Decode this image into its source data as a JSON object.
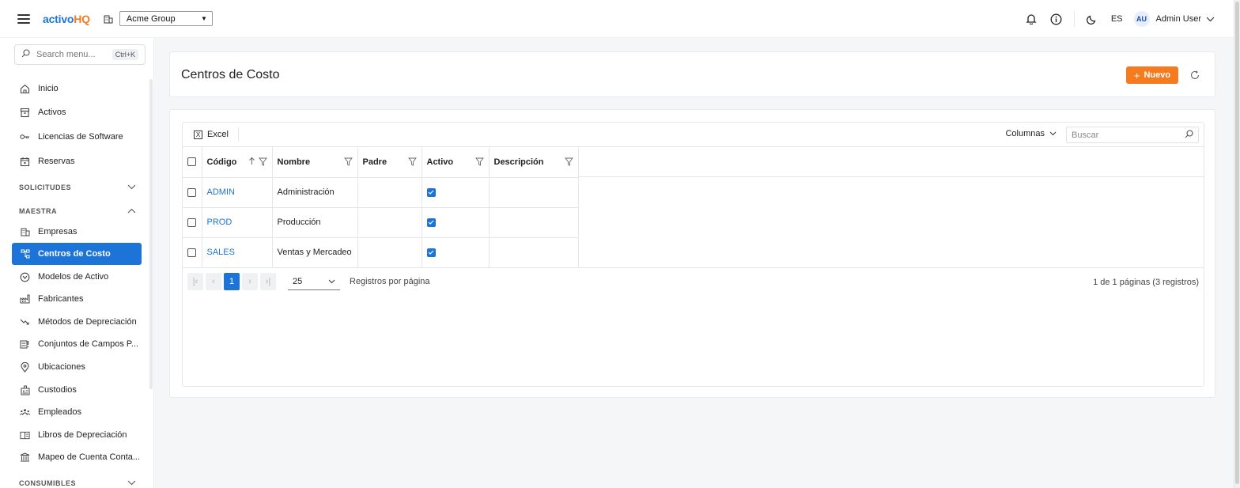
{
  "header": {
    "logo_part1": "activo",
    "logo_part2": "HQ",
    "company_selected": "Acme Group",
    "lang": "ES",
    "avatar_initials": "AU",
    "username": "Admin User"
  },
  "sidebar": {
    "search_placeholder": "Search menu...",
    "search_shortcut": "Ctrl+K",
    "top_items": [
      {
        "label": "Inicio",
        "icon": "home-icon"
      },
      {
        "label": "Activos",
        "icon": "archive-icon"
      },
      {
        "label": "Licencias de Software",
        "icon": "key-icon"
      },
      {
        "label": "Reservas",
        "icon": "calendar-icon"
      }
    ],
    "section_solicitudes": "SOLICITUDES",
    "section_maestra": "MAESTRA",
    "maestra_items": [
      {
        "label": "Empresas",
        "icon": "building-icon"
      },
      {
        "label": "Centros de Costo",
        "icon": "hierarchy-icon"
      },
      {
        "label": "Modelos de Activo",
        "icon": "model-icon"
      },
      {
        "label": "Fabricantes",
        "icon": "factory-icon"
      },
      {
        "label": "Métodos de Depreciación",
        "icon": "trend-down-icon"
      },
      {
        "label": "Conjuntos de Campos P...",
        "icon": "fields-icon"
      },
      {
        "label": "Ubicaciones",
        "icon": "location-icon"
      },
      {
        "label": "Custodios",
        "icon": "custodian-icon"
      },
      {
        "label": "Empleados",
        "icon": "people-icon"
      },
      {
        "label": "Libros de Depreciación",
        "icon": "book-icon"
      },
      {
        "label": "Mapeo de Cuenta Conta...",
        "icon": "bank-icon"
      }
    ],
    "section_consumibles": "CONSUMIBLES"
  },
  "page": {
    "title": "Centros de Costo",
    "new_button": "Nuevo"
  },
  "grid": {
    "excel_label": "Excel",
    "columns_label": "Columnas",
    "search_placeholder": "Buscar",
    "headers": [
      "Código",
      "Nombre",
      "Padre",
      "Activo",
      "Descripción"
    ],
    "rows": [
      {
        "codigo": "ADMIN",
        "nombre": "Administración",
        "padre": "",
        "activo": true,
        "descripcion": ""
      },
      {
        "codigo": "PROD",
        "nombre": "Producción",
        "padre": "",
        "activo": true,
        "descripcion": ""
      },
      {
        "codigo": "SALES",
        "nombre": "Ventas y Mercadeo",
        "padre": "",
        "activo": true,
        "descripcion": ""
      }
    ],
    "current_page": "1",
    "page_size": "25",
    "page_size_label": "Registros por página",
    "page_info": "1 de 1 páginas (3 registros)"
  },
  "colors": {
    "primary": "#1d74d8",
    "accent": "#f47b20"
  }
}
